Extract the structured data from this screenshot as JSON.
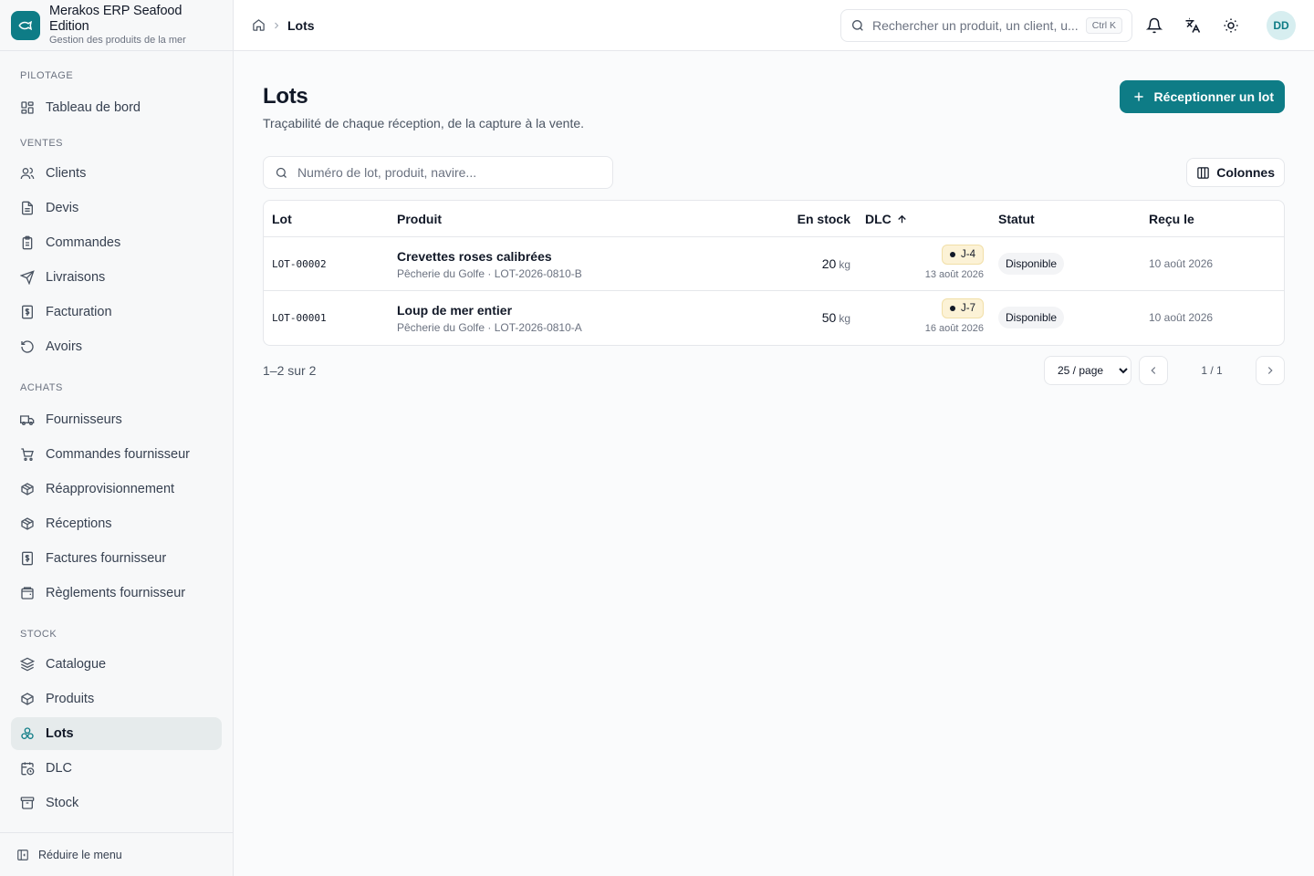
{
  "app": {
    "name": "Merakos ERP Seafood Edition",
    "subtitle": "Gestion des produits de la mer",
    "accent": "#0e7c86"
  },
  "sidebar": {
    "sections": [
      {
        "label": "PILOTAGE",
        "items": [
          {
            "label": "Tableau de bord",
            "icon": "dashboard-icon"
          }
        ]
      },
      {
        "label": "VENTES",
        "items": [
          {
            "label": "Clients",
            "icon": "users-icon"
          },
          {
            "label": "Devis",
            "icon": "document-icon"
          },
          {
            "label": "Commandes",
            "icon": "clipboard-icon"
          },
          {
            "label": "Livraisons",
            "icon": "send-icon"
          },
          {
            "label": "Facturation",
            "icon": "invoice-icon"
          },
          {
            "label": "Avoirs",
            "icon": "refund-icon"
          }
        ]
      },
      {
        "label": "ACHATS",
        "items": [
          {
            "label": "Fournisseurs",
            "icon": "truck-icon"
          },
          {
            "label": "Commandes fournisseur",
            "icon": "cart-icon"
          },
          {
            "label": "Réapprovisionnement",
            "icon": "package-icon"
          },
          {
            "label": "Réceptions",
            "icon": "package-icon"
          },
          {
            "label": "Factures fournisseur",
            "icon": "invoice-icon"
          },
          {
            "label": "Règlements fournisseur",
            "icon": "wallet-icon"
          }
        ]
      },
      {
        "label": "STOCK",
        "items": [
          {
            "label": "Catalogue",
            "icon": "layers-icon"
          },
          {
            "label": "Produits",
            "icon": "package-icon"
          },
          {
            "label": "Lots",
            "icon": "boxes-icon",
            "active": true
          },
          {
            "label": "DLC",
            "icon": "calendar-clock-icon"
          },
          {
            "label": "Stock",
            "icon": "archive-icon"
          }
        ]
      }
    ],
    "collapse_label": "Réduire le menu"
  },
  "header": {
    "breadcrumb_current": "Lots",
    "search_placeholder": "Rechercher un produit, un client, u...",
    "search_shortcut": "Ctrl K",
    "avatar_initials": "DD"
  },
  "page": {
    "title": "Lots",
    "subtitle": "Traçabilité de chaque réception, de la capture à la vente.",
    "primary_action": "Réceptionner un lot",
    "filter_placeholder": "Numéro de lot, produit, navire...",
    "columns_button": "Colonnes"
  },
  "table": {
    "columns": [
      "Lot",
      "Produit",
      "En stock",
      "DLC",
      "Statut",
      "Reçu le"
    ],
    "rows": [
      {
        "lot": "LOT-00002",
        "product": "Crevettes roses calibrées",
        "meta": "Pêcherie du Golfe · LOT-2026-0810-B",
        "qty": "20",
        "unit": "kg",
        "dlc_badge": "J-4",
        "dlc_date": "13 août 2026",
        "status": "Disponible",
        "received": "10 août 2026"
      },
      {
        "lot": "LOT-00001",
        "product": "Loup de mer entier",
        "meta": "Pêcherie du Golfe · LOT-2026-0810-A",
        "qty": "50",
        "unit": "kg",
        "dlc_badge": "J-7",
        "dlc_date": "16 août 2026",
        "status": "Disponible",
        "received": "10 août 2026"
      }
    ]
  },
  "pagination": {
    "count": "1–2 sur 2",
    "page_size": "25 / page",
    "page_label": "1 / 1"
  }
}
